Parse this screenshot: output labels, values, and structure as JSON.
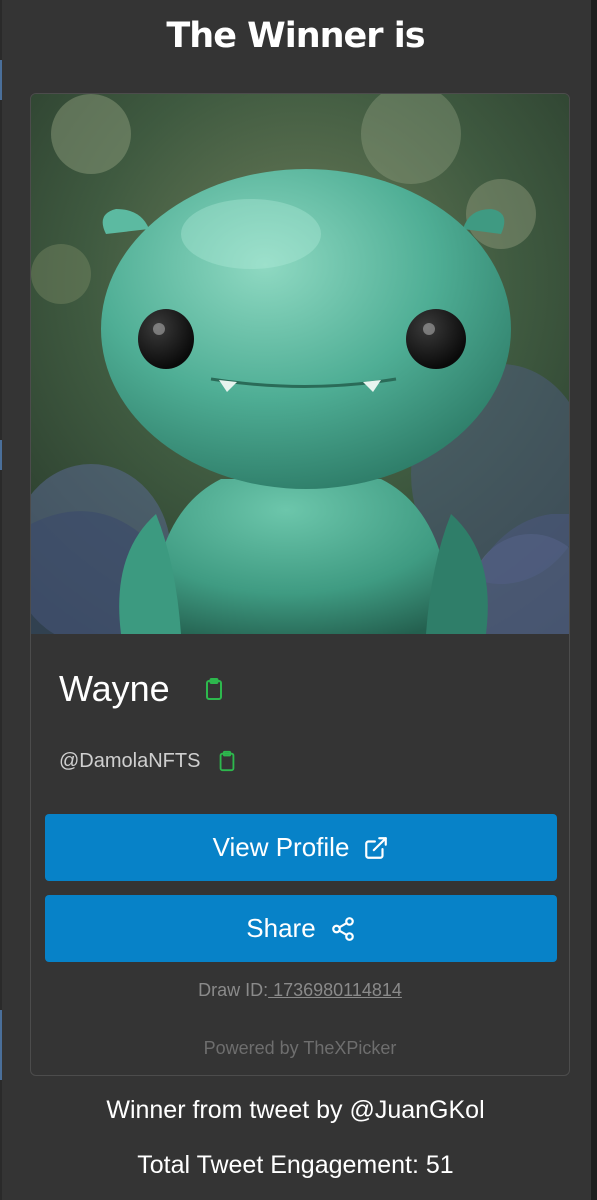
{
  "header": {
    "title": "The Winner is"
  },
  "winner": {
    "avatar_icon": "green-creature-avatar",
    "name": "Wayne",
    "handle": "@DamolaNFTS",
    "copy_icon": "clipboard-icon"
  },
  "actions": {
    "view_profile_label": "View Profile",
    "view_profile_icon": "external-link-icon",
    "share_label": "Share",
    "share_icon": "share-icon"
  },
  "draw": {
    "label": "Draw ID:",
    "id": " 1736980114814"
  },
  "footer": {
    "powered_by": "Powered by TheXPicker"
  },
  "summary": {
    "winner_from": "Winner from tweet by @JuanGKol",
    "engagement": "Total Tweet Engagement: 51"
  },
  "colors": {
    "background": "#343434",
    "button": "#0782c8",
    "copy_icon": "#2db84d",
    "muted_text": "#8a8a8a"
  }
}
